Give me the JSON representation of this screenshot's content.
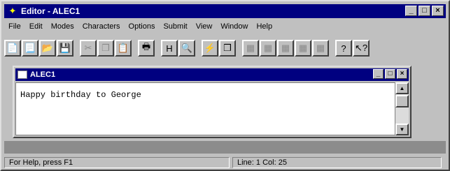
{
  "window": {
    "title": "Editor - ALEC1",
    "minimize": "_",
    "maximize": "□",
    "close": "×"
  },
  "menu": [
    "File",
    "Edit",
    "Modes",
    "Characters",
    "Options",
    "Submit",
    "View",
    "Window",
    "Help"
  ],
  "toolbar": {
    "groups": [
      [
        {
          "name": "new-doc-icon",
          "glyph": "📄"
        },
        {
          "name": "new-template-icon",
          "glyph": "📃"
        },
        {
          "name": "open-folder-icon",
          "glyph": "📂"
        },
        {
          "name": "save-disk-icon",
          "glyph": "💾"
        }
      ],
      [
        {
          "name": "cut-icon",
          "glyph": "✂",
          "disabled": true
        },
        {
          "name": "copy-icon",
          "glyph": "❐",
          "disabled": true
        },
        {
          "name": "paste-icon",
          "glyph": "📋",
          "disabled": true
        }
      ],
      [
        {
          "name": "print-icon",
          "glyph": "🖶"
        }
      ],
      [
        {
          "name": "format-icon",
          "glyph": "H"
        },
        {
          "name": "preview-icon",
          "glyph": "🔍"
        }
      ],
      [
        {
          "name": "submit-icon",
          "glyph": "⚡"
        },
        {
          "name": "pages-icon",
          "glyph": "❒"
        }
      ],
      [
        {
          "name": "tool-a-icon",
          "glyph": "▦",
          "disabled": true
        },
        {
          "name": "tool-b-icon",
          "glyph": "▦",
          "disabled": true
        },
        {
          "name": "tool-c-icon",
          "glyph": "▦",
          "disabled": true
        },
        {
          "name": "tool-d-icon",
          "glyph": "▦",
          "disabled": true
        },
        {
          "name": "tool-e-icon",
          "glyph": "▦",
          "disabled": true
        }
      ],
      [
        {
          "name": "help-icon",
          "glyph": "?"
        },
        {
          "name": "context-help-icon",
          "glyph": "↖?"
        }
      ]
    ]
  },
  "document": {
    "title": "ALEC1",
    "content": "Happy birthday to George",
    "minimize": "_",
    "maximize": "□",
    "close": "×"
  },
  "status": {
    "help": "For Help, press F1",
    "position": "Line: 1  Col: 25"
  }
}
